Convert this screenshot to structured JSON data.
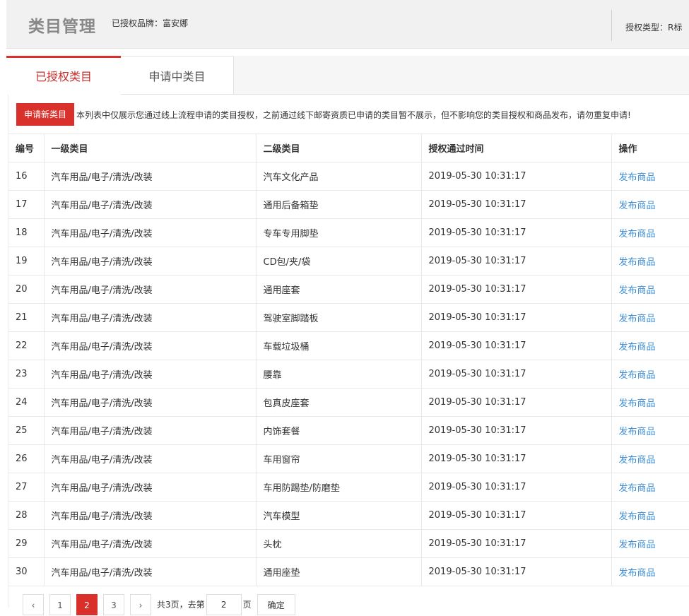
{
  "header": {
    "title": "类目管理",
    "brand": "已授权品牌：富安娜",
    "auth_type": "授权类型：R标"
  },
  "tabs": [
    {
      "label": "已授权类目",
      "active": true
    },
    {
      "label": "申请中类目",
      "active": false
    }
  ],
  "toolbar": {
    "apply_label": "申请新类目",
    "notice": "本列表中仅展示您通过线上流程申请的类目授权，之前通过线下邮寄资质已申请的类目暂不展示，但不影响您的类目授权和商品发布，请勿重复申请!"
  },
  "table": {
    "columns": [
      "编号",
      "一级类目",
      "二级类目",
      "授权通过时间",
      "操作"
    ],
    "rows": [
      {
        "id": "16",
        "level1": "汽车用品/电子/清洗/改装",
        "level2": "汽车文化产品",
        "time": "2019-05-30 10:31:17",
        "action": "发布商品"
      },
      {
        "id": "17",
        "level1": "汽车用品/电子/清洗/改装",
        "level2": "通用后备箱垫",
        "time": "2019-05-30 10:31:17",
        "action": "发布商品"
      },
      {
        "id": "18",
        "level1": "汽车用品/电子/清洗/改装",
        "level2": "专车专用脚垫",
        "time": "2019-05-30 10:31:17",
        "action": "发布商品"
      },
      {
        "id": "19",
        "level1": "汽车用品/电子/清洗/改装",
        "level2": "CD包/夹/袋",
        "time": "2019-05-30 10:31:17",
        "action": "发布商品"
      },
      {
        "id": "20",
        "level1": "汽车用品/电子/清洗/改装",
        "level2": "通用座套",
        "time": "2019-05-30 10:31:17",
        "action": "发布商品"
      },
      {
        "id": "21",
        "level1": "汽车用品/电子/清洗/改装",
        "level2": "驾驶室脚踏板",
        "time": "2019-05-30 10:31:17",
        "action": "发布商品"
      },
      {
        "id": "22",
        "level1": "汽车用品/电子/清洗/改装",
        "level2": "车载垃圾桶",
        "time": "2019-05-30 10:31:17",
        "action": "发布商品"
      },
      {
        "id": "23",
        "level1": "汽车用品/电子/清洗/改装",
        "level2": "腰靠",
        "time": "2019-05-30 10:31:17",
        "action": "发布商品"
      },
      {
        "id": "24",
        "level1": "汽车用品/电子/清洗/改装",
        "level2": "包真皮座套",
        "time": "2019-05-30 10:31:17",
        "action": "发布商品"
      },
      {
        "id": "25",
        "level1": "汽车用品/电子/清洗/改装",
        "level2": "内饰套餐",
        "time": "2019-05-30 10:31:17",
        "action": "发布商品"
      },
      {
        "id": "26",
        "level1": "汽车用品/电子/清洗/改装",
        "level2": "车用窗帘",
        "time": "2019-05-30 10:31:17",
        "action": "发布商品"
      },
      {
        "id": "27",
        "level1": "汽车用品/电子/清洗/改装",
        "level2": "车用防踢垫/防磨垫",
        "time": "2019-05-30 10:31:17",
        "action": "发布商品"
      },
      {
        "id": "28",
        "level1": "汽车用品/电子/清洗/改装",
        "level2": "汽车模型",
        "time": "2019-05-30 10:31:17",
        "action": "发布商品"
      },
      {
        "id": "29",
        "level1": "汽车用品/电子/清洗/改装",
        "level2": "头枕",
        "time": "2019-05-30 10:31:17",
        "action": "发布商品"
      },
      {
        "id": "30",
        "level1": "汽车用品/电子/清洗/改装",
        "level2": "通用座垫",
        "time": "2019-05-30 10:31:17",
        "action": "发布商品"
      }
    ]
  },
  "pagination": {
    "prev_icon": "chevron-left-icon",
    "next_icon": "chevron-right-icon",
    "pages": [
      "1",
      "2",
      "3"
    ],
    "current_page": "2",
    "total_text": "共3页，去第",
    "goto_value": "2",
    "page_suffix": "页",
    "confirm_label": "确定"
  },
  "colors": {
    "accent": "#d9302c",
    "link": "#3d8fd6",
    "header_bg": "#f1f1f1"
  }
}
